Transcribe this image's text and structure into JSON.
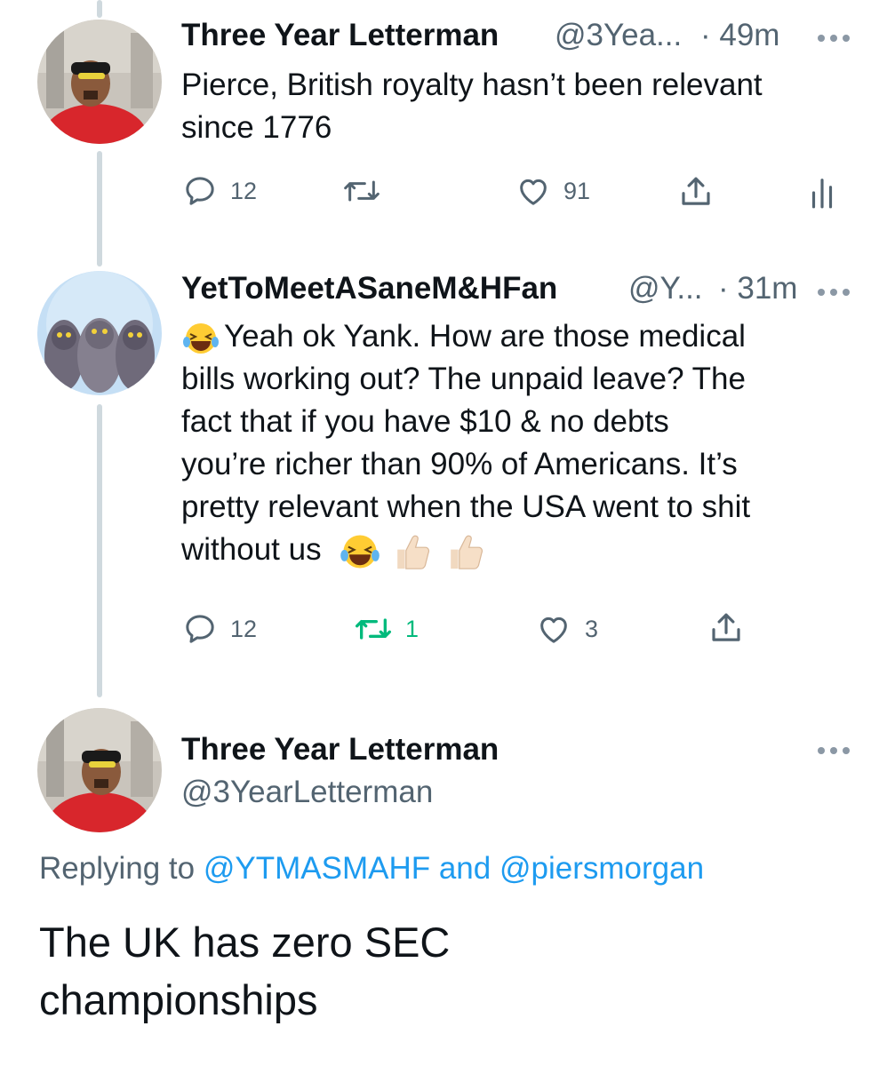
{
  "tweets": [
    {
      "name": "Three Year Letterman",
      "handle": "@3Yea...",
      "time": "· 49m",
      "lines": [
        "Pierce, British royalty hasn’t been relevant",
        "since 1776"
      ],
      "replies": "12",
      "retweets": "",
      "likes": "91"
    },
    {
      "name": "YetToMeetASaneM&HFan",
      "handle": "@Y...",
      "time": "· 31m",
      "lines": [
        "Yeah ok Yank. How are those medical",
        "bills working out? The unpaid leave? The",
        "fact that if you have $10 & no debts",
        "you’re richer than 90% of Americans. It’s",
        "pretty relevant when the USA went to shit",
        "without us"
      ],
      "replies": "12",
      "retweets": "1",
      "likes": "3"
    }
  ],
  "focused": {
    "name": "Three Year Letterman",
    "handle": "@3YearLetterman",
    "replying_prefix": "Replying to",
    "reply_to_1": "@YTMASMAHF",
    "reply_and": "and",
    "reply_to_2": "@piersmorgan",
    "lines": [
      "The UK has zero SEC",
      "championships"
    ]
  },
  "colors": {
    "link": "#1d9bf0",
    "retweet_active": "#00ba7c",
    "secondary_text": "#536471",
    "thread_line": "#cfd9de"
  },
  "icons": [
    "reply-icon",
    "retweet-icon",
    "like-icon",
    "share-icon",
    "analytics-icon",
    "more-icon",
    "laughing-emoji",
    "thumbs-up-emoji"
  ]
}
